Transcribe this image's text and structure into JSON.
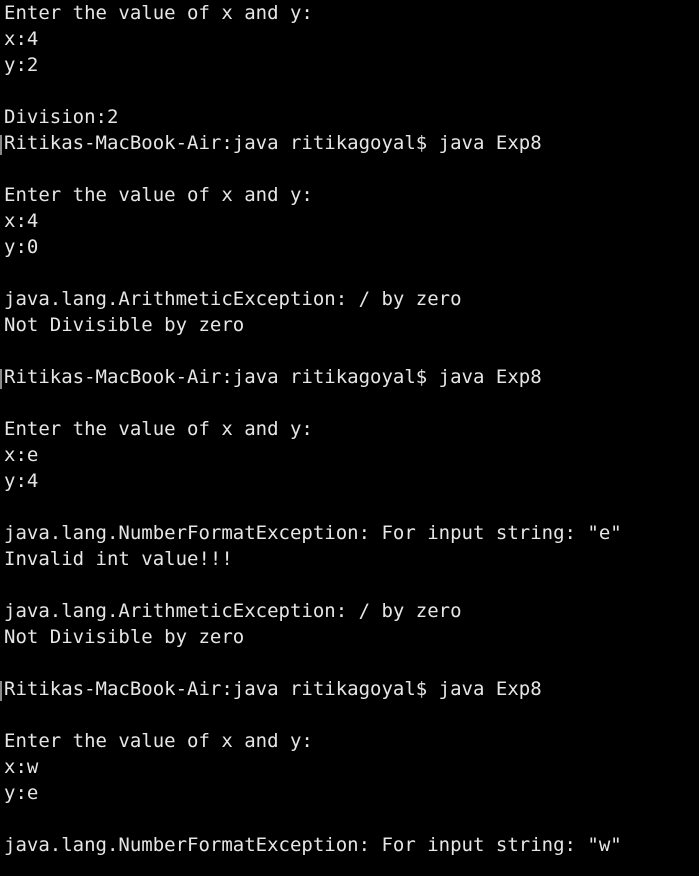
{
  "terminal": {
    "lines": [
      "Enter the value of x and y:",
      "x:4",
      "y:2",
      "",
      "Division:2",
      "Ritikas-MacBook-Air:java ritikagoyal$ java Exp8",
      "",
      "Enter the value of x and y:",
      "x:4",
      "y:0",
      "",
      "java.lang.ArithmeticException: / by zero",
      "Not Divisible by zero",
      "",
      "Ritikas-MacBook-Air:java ritikagoyal$ java Exp8",
      "",
      "Enter the value of x and y:",
      "x:e",
      "y:4",
      "",
      "java.lang.NumberFormatException: For input string: \"e\"",
      "Invalid int value!!!",
      "",
      "java.lang.ArithmeticException: / by zero",
      "Not Divisible by zero",
      "",
      "Ritikas-MacBook-Air:java ritikagoyal$ java Exp8",
      "",
      "Enter the value of x and y:",
      "x:w",
      "y:e",
      "",
      "java.lang.NumberFormatException: For input string: \"w\""
    ]
  },
  "colors": {
    "background": "#000000",
    "text": "#e6e6e6",
    "prompt_marker": "#8a8a8a"
  }
}
